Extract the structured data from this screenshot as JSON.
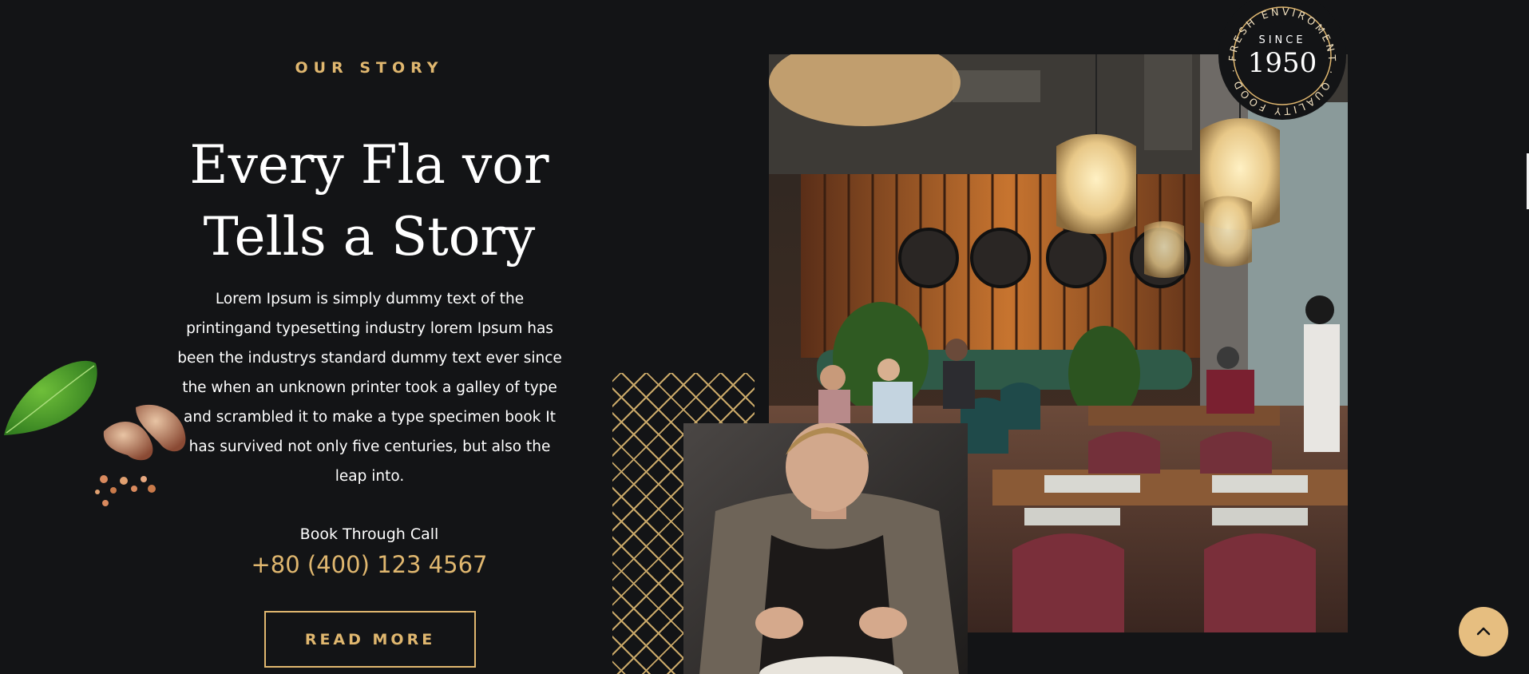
{
  "story": {
    "eyebrow": "OUR STORY",
    "headline_line1": "Every Fla vor",
    "headline_line2": "Tells a Story",
    "body": "Lorem Ipsum is simply dummy text of the printingand typesetting industry lorem Ipsum has been the industrys standard dummy text ever since the when an unknown printer took a galley of type and scrambled it to make a type specimen book It has survived not only five centuries, but also the leap into.",
    "call_label": "Book Through Call",
    "phone": "+80 (400) 123 4567",
    "read_more_label": "READ MORE"
  },
  "badge": {
    "since_label": "SINCE",
    "year": "1950",
    "ring_text": "FRESH ENVIROMENT · QUALITY FOOD ·"
  },
  "icons": {
    "scroll_top": "chevron-up-icon",
    "herbs": "basil-garlic-decoration",
    "pattern": "geometric-pattern"
  },
  "colors": {
    "background": "#131416",
    "accent": "#e0b76f",
    "scroll_button": "#e6be80",
    "text": "#ffffff"
  }
}
